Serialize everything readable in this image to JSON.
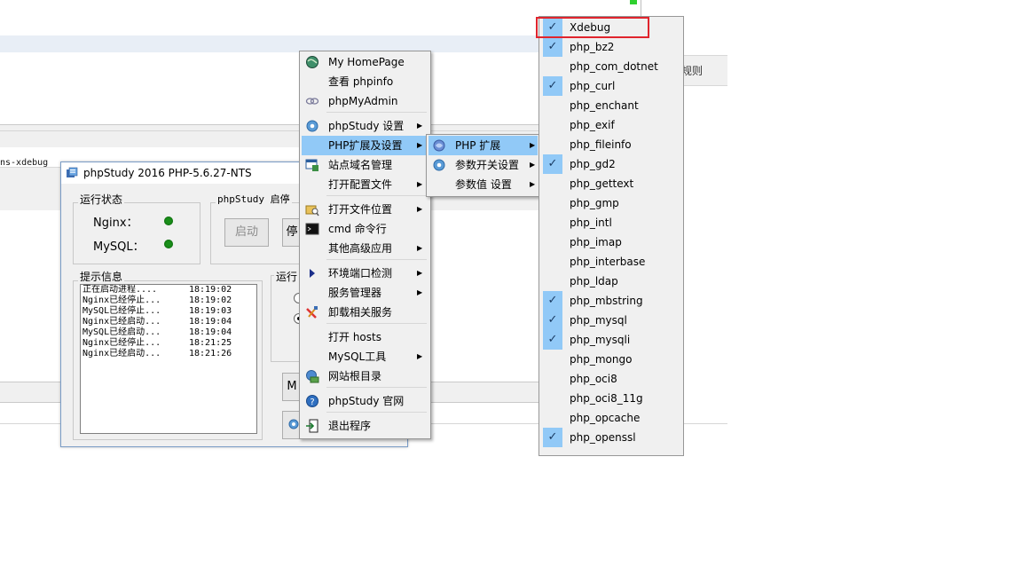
{
  "background": {
    "command_fragment": "ns-xdebug",
    "right_fragment": "规则"
  },
  "window": {
    "title": "phpStudy 2016   PHP-5.6.27-NTS",
    "status_group": "运行状态",
    "nginx_label": "Nginx：",
    "mysql_label": "MySQL：",
    "control_group": "phpStudy 启停",
    "start_button": "启动",
    "stop_button_partial": "停",
    "log_group": "提示信息",
    "mode_group_partial": "运行",
    "lower_button_partial": "M",
    "log_entries": [
      {
        "msg": "正在启动进程....",
        "time": "18:19:02"
      },
      {
        "msg": "Nginx已经停止...",
        "time": "18:19:02"
      },
      {
        "msg": "MySQL已经停止...",
        "time": "18:19:03"
      },
      {
        "msg": "Nginx已经启动...",
        "time": "18:19:04"
      },
      {
        "msg": "MySQL已经启动...",
        "time": "18:19:04"
      },
      {
        "msg": "Nginx已经停止...",
        "time": "18:21:25"
      },
      {
        "msg": "Nginx已经启动...",
        "time": "18:21:26"
      }
    ]
  },
  "main_menu": {
    "items": [
      {
        "label": "My HomePage",
        "icon": "globe-icon",
        "submenu": false
      },
      {
        "label": "查看 phpinfo",
        "icon": "",
        "submenu": false
      },
      {
        "label": "phpMyAdmin",
        "icon": "phpmyadmin-icon",
        "submenu": false
      },
      {
        "label": "phpStudy 设置",
        "icon": "gear-icon",
        "submenu": true
      },
      {
        "label": "PHP扩展及设置",
        "icon": "",
        "submenu": true,
        "highlighted": true
      },
      {
        "label": "站点域名管理",
        "icon": "site-manager-icon",
        "submenu": false
      },
      {
        "label": "打开配置文件",
        "icon": "",
        "submenu": true
      },
      {
        "label": "打开文件位置",
        "icon": "folder-search-icon",
        "submenu": true
      },
      {
        "label": "cmd 命令行",
        "icon": "terminal-icon",
        "submenu": false
      },
      {
        "label": "其他高级应用",
        "icon": "",
        "submenu": true
      },
      {
        "label": "环境端口检测",
        "icon": "arrow-play-icon",
        "submenu": true
      },
      {
        "label": "服务管理器",
        "icon": "",
        "submenu": true
      },
      {
        "label": "卸载相关服务",
        "icon": "uninstall-icon",
        "submenu": false
      },
      {
        "label": "打开 hosts",
        "icon": "",
        "submenu": false
      },
      {
        "label": "MySQL工具",
        "icon": "",
        "submenu": true
      },
      {
        "label": "网站根目录",
        "icon": "web-root-icon",
        "submenu": false
      },
      {
        "label": "phpStudy 官网",
        "icon": "help-icon",
        "submenu": false
      },
      {
        "label": "退出程序",
        "icon": "exit-icon",
        "submenu": false
      }
    ]
  },
  "php_submenu": {
    "items": [
      {
        "label": "PHP 扩展",
        "icon": "php-ext-icon",
        "highlighted": true
      },
      {
        "label": "参数开关设置",
        "icon": "gear-icon",
        "highlighted": false
      },
      {
        "label": "参数值 设置",
        "icon": "",
        "highlighted": false
      }
    ]
  },
  "extensions": {
    "items": [
      {
        "name": "Xdebug",
        "checked": true
      },
      {
        "name": "php_bz2",
        "checked": true
      },
      {
        "name": "php_com_dotnet",
        "checked": false
      },
      {
        "name": "php_curl",
        "checked": true
      },
      {
        "name": "php_enchant",
        "checked": false
      },
      {
        "name": "php_exif",
        "checked": false
      },
      {
        "name": "php_fileinfo",
        "checked": false
      },
      {
        "name": "php_gd2",
        "checked": true
      },
      {
        "name": "php_gettext",
        "checked": false
      },
      {
        "name": "php_gmp",
        "checked": false
      },
      {
        "name": "php_intl",
        "checked": false
      },
      {
        "name": "php_imap",
        "checked": false
      },
      {
        "name": "php_interbase",
        "checked": false
      },
      {
        "name": "php_ldap",
        "checked": false
      },
      {
        "name": "php_mbstring",
        "checked": true
      },
      {
        "name": "php_mysql",
        "checked": true
      },
      {
        "name": "php_mysqli",
        "checked": true
      },
      {
        "name": "php_mongo",
        "checked": false
      },
      {
        "name": "php_oci8",
        "checked": false
      },
      {
        "name": "php_oci8_11g",
        "checked": false
      },
      {
        "name": "php_opcache",
        "checked": false
      },
      {
        "name": "php_openssl",
        "checked": true
      }
    ]
  },
  "colors": {
    "highlight": "#91c9f7",
    "status_green": "#1a8f1a",
    "annotation_red": "#e0242d"
  }
}
